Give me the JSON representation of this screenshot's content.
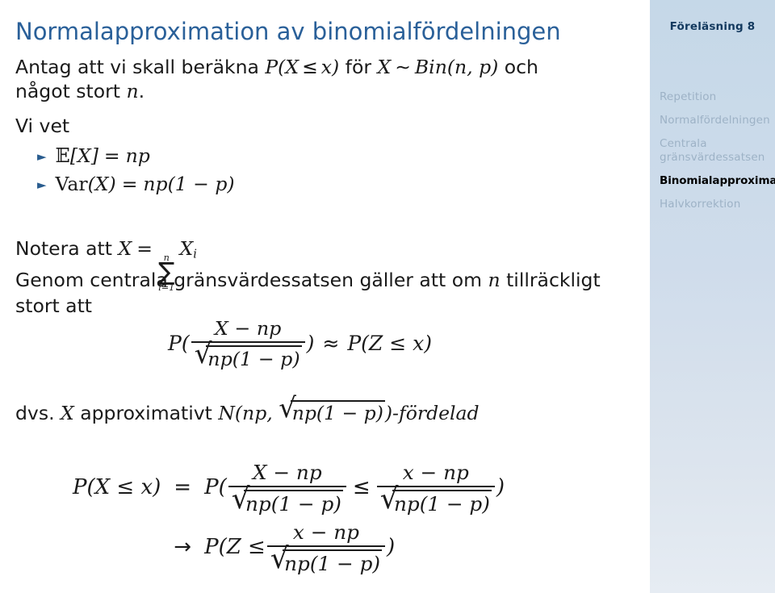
{
  "slide": {
    "title": "Normalapproximation av binomialfördelningen",
    "title_color": "#2a6099",
    "background": "#ffffff"
  },
  "sidebar": {
    "background_top": "#c5d8e8",
    "background_bottom": "#e6ecf3",
    "title": "Föreläsning 8",
    "title_color": "#13395e",
    "inactive_color": "#9db2c6",
    "active_color": "#000000",
    "items": [
      {
        "label": "Repetition",
        "active": false
      },
      {
        "label": "Normalfördelningen",
        "active": false
      },
      {
        "label": "Centrala gränsvärdessatsen",
        "active": false
      },
      {
        "label": "Binomialapproximation",
        "active": true
      },
      {
        "label": "Halvkorrektion",
        "active": false
      }
    ]
  },
  "body": {
    "line_antag_1": "Antag att vi skall beräkna ",
    "line_antag_math_1": "P(X",
    "line_antag_le": "≤",
    "line_antag_math_2": "x)",
    "line_antag_2": " för ",
    "line_antag_var": "X",
    "line_antag_sim": "∼",
    "line_antag_dist": "Bin(n, p)",
    "line_antag_3": " och",
    "line_nagot_1": "något stort ",
    "line_nagot_n": "n",
    "line_nagot_2": ".",
    "line_vivet": "Vi vet",
    "bullets": [
      {
        "marker": "►",
        "expectation": "E",
        "lhs": "[X]",
        "eq": "=",
        "rhs": "np"
      },
      {
        "marker": "►",
        "var_label": "Var",
        "lhs": "(X)",
        "eq": "=",
        "rhs": "np(1 − p)"
      }
    ],
    "line_notera_text": "Notera att ",
    "line_notera_X": "X",
    "line_notera_eq": "=",
    "sum_sup": "n",
    "sum_symbol": "∑",
    "sum_sub": "i=1",
    "sum_term": "X",
    "sum_term_sub": "i",
    "line_genom_1": "Genom centrala gränsvärdessatsen gäller att om ",
    "line_genom_n": "n",
    "line_genom_2": " tillräckligt",
    "line_stort": "stort att",
    "line_dvs_1": "dvs. ",
    "line_dvs_X": "X",
    "line_dvs_2": " approximativt ",
    "line_dvs_N": "N(np, ",
    "line_dvs_sqrt": "np(1 − p)",
    "line_dvs_3": ")-fördelad"
  },
  "equations": {
    "display1": {
      "p_open": "P(",
      "numerator": "X − np",
      "denominator": "np(1 − p)",
      "p_close": ")",
      "approx": "≈",
      "rhs": "P(Z ≤ x)"
    },
    "align": {
      "row1_lhs": "P(X ≤ x)",
      "row1_rel": "=",
      "row1_rhs_p_open": "P(",
      "row1_frac1_num": "X − np",
      "row1_frac1_den": "np(1 − p)",
      "row1_rel_inner": "≤",
      "row1_frac2_num": "x − np",
      "row1_frac2_den": "np(1 − p)",
      "row1_rhs_p_close": ")",
      "row2_rel": "→",
      "row2_p_open": "P(Z ≤ ",
      "row2_frac_num": "x − np",
      "row2_frac_den": "np(1 − p)",
      "row2_p_close": ")"
    }
  },
  "symbols": {
    "radical": "√",
    "bullet_triangle": "►",
    "blackboard_E": "𝔼"
  }
}
